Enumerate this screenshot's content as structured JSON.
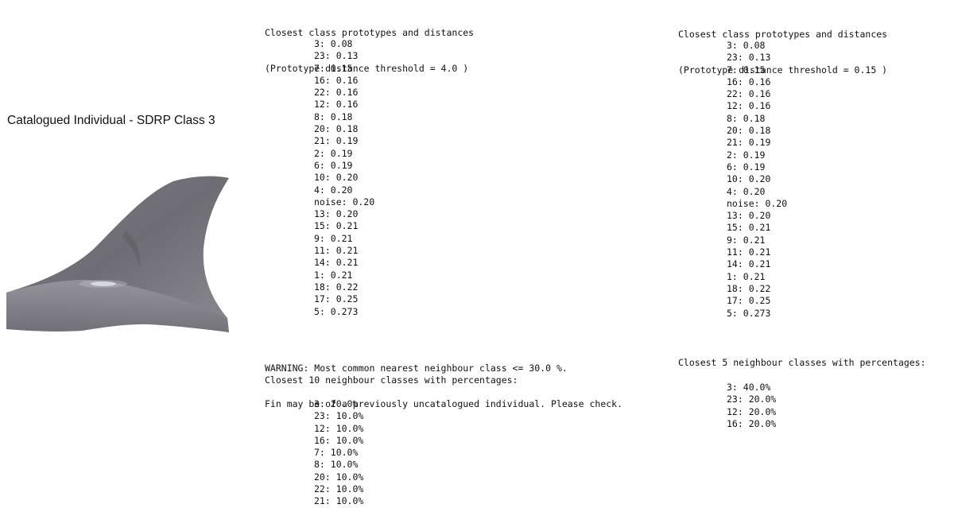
{
  "left_panel": {
    "caption": "Catalogued Individual - SDRP Class 3"
  },
  "analysis_1": {
    "heading": "Closest class prototypes and distances",
    "threshold": "(Prototype distance threshold = 4.0 )",
    "distances": [
      "3: 0.08",
      "23: 0.13",
      "7: 0.15",
      "16: 0.16",
      "22: 0.16",
      "12: 0.16",
      "8: 0.18",
      "20: 0.18",
      "21: 0.19",
      "2: 0.19",
      "6: 0.19",
      "10: 0.20",
      "4: 0.20",
      "noise: 0.20",
      "13: 0.20",
      "15: 0.21",
      "9: 0.21",
      "11: 0.21",
      "14: 0.21",
      "1: 0.21",
      "18: 0.22",
      "17: 0.25",
      "5: 0.273"
    ],
    "warning_line1": "WARNING: Most common nearest neighbour class <= 30.0 %.",
    "warning_line2": "Fin may be of a previously uncatalogued individual. Please check.",
    "neighbours_heading": "Closest 10 neighbour classes with percentages:",
    "neighbours": [
      "3: 20.0%",
      "23: 10.0%",
      "12: 10.0%",
      "16: 10.0%",
      "7: 10.0%",
      "8: 10.0%",
      "20: 10.0%",
      "22: 10.0%",
      "21: 10.0%"
    ]
  },
  "analysis_2": {
    "heading": "Closest class prototypes and distances",
    "threshold": "(Prototype distance threshold = 0.15 )",
    "distances": [
      "3: 0.08",
      "23: 0.13",
      "7: 0.15",
      "16: 0.16",
      "22: 0.16",
      "12: 0.16",
      "8: 0.18",
      "20: 0.18",
      "21: 0.19",
      "2: 0.19",
      "6: 0.19",
      "10: 0.20",
      "4: 0.20",
      "noise: 0.20",
      "13: 0.20",
      "15: 0.21",
      "9: 0.21",
      "11: 0.21",
      "14: 0.21",
      "1: 0.21",
      "18: 0.22",
      "17: 0.25",
      "5: 0.273"
    ],
    "neighbours_heading": "Closest 5 neighbour classes with percentages:",
    "neighbours": [
      "3: 40.0%",
      "23: 20.0%",
      "12: 20.0%",
      "16: 20.0%"
    ]
  }
}
